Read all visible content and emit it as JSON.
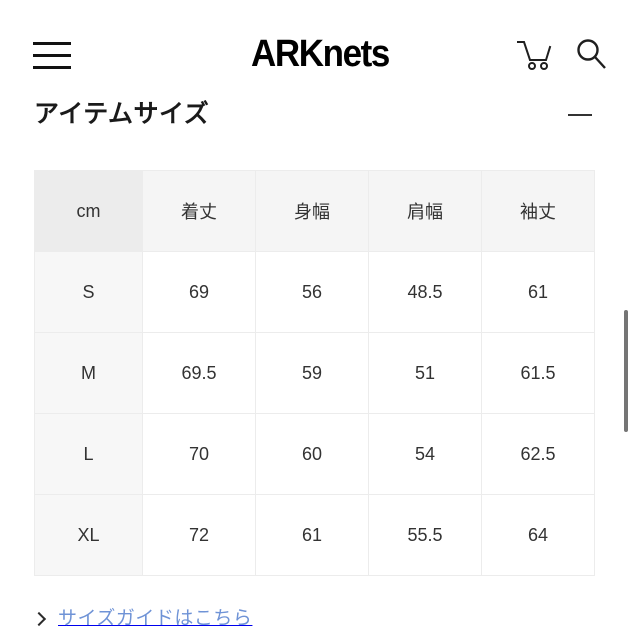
{
  "header": {
    "brand": "ARKnets",
    "menu_label": "menu",
    "cart_label": "cart",
    "search_label": "search"
  },
  "section": {
    "title": "アイテムサイズ",
    "collapse_label": "−"
  },
  "table": {
    "unit_header": "cm",
    "columns": [
      "着丈",
      "身幅",
      "肩幅",
      "袖丈"
    ],
    "rows": [
      {
        "size": "S",
        "values": [
          "69",
          "56",
          "48.5",
          "61"
        ]
      },
      {
        "size": "M",
        "values": [
          "69.5",
          "59",
          "51",
          "61.5"
        ]
      },
      {
        "size": "L",
        "values": [
          "70",
          "60",
          "54",
          "62.5"
        ]
      },
      {
        "size": "XL",
        "values": [
          "72",
          "61",
          "55.5",
          "64"
        ]
      }
    ]
  },
  "footer_link": {
    "text": "サイズガイドはこちら",
    "chevron": "›"
  },
  "colors": {
    "link": "#6f93d6",
    "header_cell_bg": "#f5f5f5",
    "corner_cell_bg": "#ececec",
    "rowhead_bg": "#f7f7f7",
    "text": "#333333",
    "scrollbar_thumb": "#757575"
  }
}
